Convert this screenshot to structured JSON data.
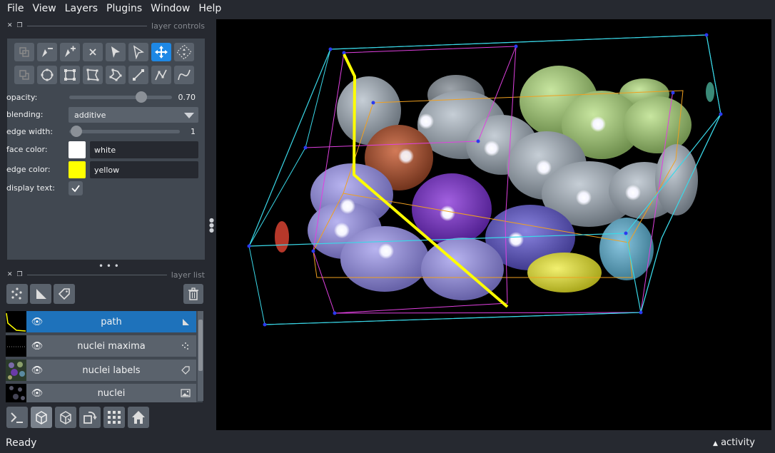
{
  "menu": [
    "File",
    "View",
    "Layers",
    "Plugins",
    "Window",
    "Help"
  ],
  "layer_controls_title": "layer controls",
  "layer_list_title": "layer list",
  "controls": {
    "opacity_label": "opacity:",
    "opacity_value": "0.70",
    "opacity_fraction": 0.7,
    "blending_label": "blending:",
    "blending_value": "additive",
    "edge_width_label": "edge width:",
    "edge_width_value": "1",
    "face_color_label": "face color:",
    "face_color_value": "white",
    "face_color_hex": "#ffffff",
    "edge_color_label": "edge color:",
    "edge_color_value": "yellow",
    "edge_color_hex": "#ffff00",
    "display_text_label": "display text:",
    "display_text_checked": true
  },
  "shape_tools": [
    [
      "move-front-icon",
      "remove-vertex-icon",
      "add-vertex-icon",
      "delete-shape-icon",
      "select-icon",
      "direct-select-icon",
      "pan-zoom-icon",
      "transform-icon"
    ],
    [
      "move-back-icon",
      "ellipse-icon",
      "rectangle-icon",
      "polygon-icon",
      "lasso-icon",
      "line-icon",
      "path-icon",
      "polyline-icon"
    ]
  ],
  "active_tool": "pan-zoom-icon",
  "layers": [
    {
      "name": "path",
      "type_icon": "shapes-icon",
      "selected": true
    },
    {
      "name": "nuclei maxima",
      "type_icon": "points-icon",
      "selected": false
    },
    {
      "name": "nuclei labels",
      "type_icon": "labels-icon",
      "selected": false
    },
    {
      "name": "nuclei",
      "type_icon": "image-icon",
      "selected": false
    }
  ],
  "status": {
    "text": "Ready",
    "activity": "activity"
  }
}
